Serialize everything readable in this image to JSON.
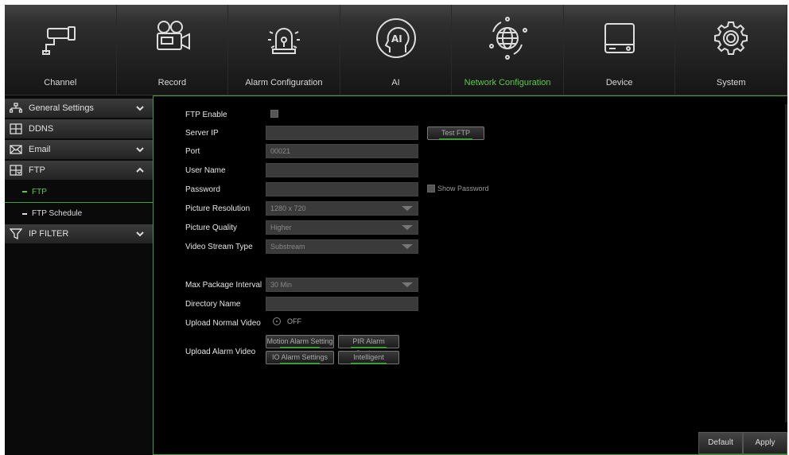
{
  "nav": {
    "tabs": [
      {
        "label": "Channel",
        "icon": "camera-icon"
      },
      {
        "label": "Record",
        "icon": "video-camera-icon"
      },
      {
        "label": "Alarm Configuration",
        "icon": "alarm-light-icon"
      },
      {
        "label": "AI",
        "icon": "ai-head-icon"
      },
      {
        "label": "Network Configuration",
        "icon": "globe-network-icon",
        "active": true
      },
      {
        "label": "Device",
        "icon": "hard-drive-icon"
      },
      {
        "label": "System",
        "icon": "gear-icon"
      }
    ]
  },
  "sidebar": {
    "items": [
      {
        "label": "General Settings",
        "icon": "network-icon",
        "chevron": "down"
      },
      {
        "label": "DDNS",
        "icon": "ddns-icon"
      },
      {
        "label": "Email",
        "icon": "email-icon",
        "chevron": "down"
      },
      {
        "label": "FTP",
        "icon": "ftp-icon",
        "chevron": "up"
      }
    ],
    "sub_items": [
      {
        "label": "FTP",
        "active": true
      },
      {
        "label": "FTP Schedule"
      }
    ],
    "ip_filter": {
      "label": "IP FILTER",
      "icon": "filter-icon",
      "chevron": "down"
    }
  },
  "form": {
    "ftp_enable": {
      "label": "FTP Enable",
      "checked": false
    },
    "server_ip": {
      "label": "Server IP",
      "value": ""
    },
    "test_ftp_label": "Test FTP",
    "port": {
      "label": "Port",
      "value": "00021"
    },
    "user_name": {
      "label": "User Name",
      "value": ""
    },
    "password": {
      "label": "Password",
      "value": ""
    },
    "show_password_label": "Show Password",
    "picture_resolution": {
      "label": "Picture Resolution",
      "value": "1280 x 720"
    },
    "picture_quality": {
      "label": "Picture Quality",
      "value": "Higher"
    },
    "video_stream_type": {
      "label": "Video Stream Type",
      "value": "Substream"
    },
    "max_package_interval": {
      "label": "Max Package Interval",
      "value": "30 Min"
    },
    "directory_name": {
      "label": "Directory Name",
      "value": ""
    },
    "upload_normal_video": {
      "label": "Upload Normal Video",
      "state": "OFF"
    },
    "upload_alarm_video": {
      "label": "Upload Alarm Video",
      "buttons": [
        "Motion Alarm Setting",
        "PIR Alarm Settings",
        "IO Alarm Settings",
        "Intelligent"
      ]
    }
  },
  "actions": {
    "default_label": "Default",
    "apply_label": "Apply"
  },
  "colors": {
    "accent_green": "#5cc94a",
    "border_green": "#3da036",
    "background": "#000000"
  }
}
